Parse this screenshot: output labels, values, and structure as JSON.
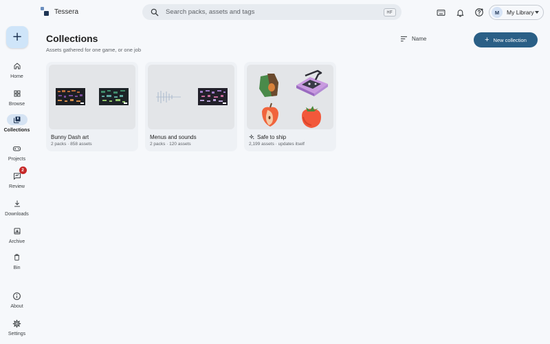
{
  "app": {
    "name": "Tessera"
  },
  "search": {
    "placeholder": "Search packs, assets and tags",
    "shortcut": "⌘F"
  },
  "topbar": {
    "icons": [
      "keyboard-icon",
      "bell-icon",
      "help-icon"
    ],
    "library": {
      "avatar_letter": "M",
      "label": "My Library"
    }
  },
  "sidebar": {
    "fab_label": "+",
    "items": [
      {
        "label": "Home",
        "icon": "home-icon"
      },
      {
        "label": "Browse",
        "icon": "grid-icon"
      },
      {
        "label": "Collections",
        "icon": "collections-icon",
        "active": true
      },
      {
        "label": "Projects",
        "icon": "gamepad-icon"
      },
      {
        "label": "Review",
        "icon": "review-icon",
        "badge": "2"
      },
      {
        "label": "Downloads",
        "icon": "download-icon"
      },
      {
        "label": "Archive",
        "icon": "archive-icon"
      },
      {
        "label": "Bin",
        "icon": "trash-icon"
      }
    ],
    "bottom_items": [
      {
        "label": "About",
        "icon": "info-icon"
      },
      {
        "label": "Settings",
        "icon": "gear-icon"
      }
    ]
  },
  "main": {
    "title": "Collections",
    "subtitle": "Assets gathered for one game, or one job",
    "sort_label": "Name",
    "new_button_label": "New collection",
    "collections": [
      {
        "title": "Bunny Dash art",
        "meta": "2 packs · 858 assets"
      },
      {
        "title": "Menus and sounds",
        "meta": "2 packs · 120 assets"
      },
      {
        "title": "Safe to ship",
        "meta": "2,199 assets · updates itself",
        "smart": true
      }
    ]
  },
  "colors": {
    "accent": "#2a5f86",
    "active_pill": "#d5e3f3",
    "fab": "#cfe5f9",
    "badge": "#c62828"
  }
}
